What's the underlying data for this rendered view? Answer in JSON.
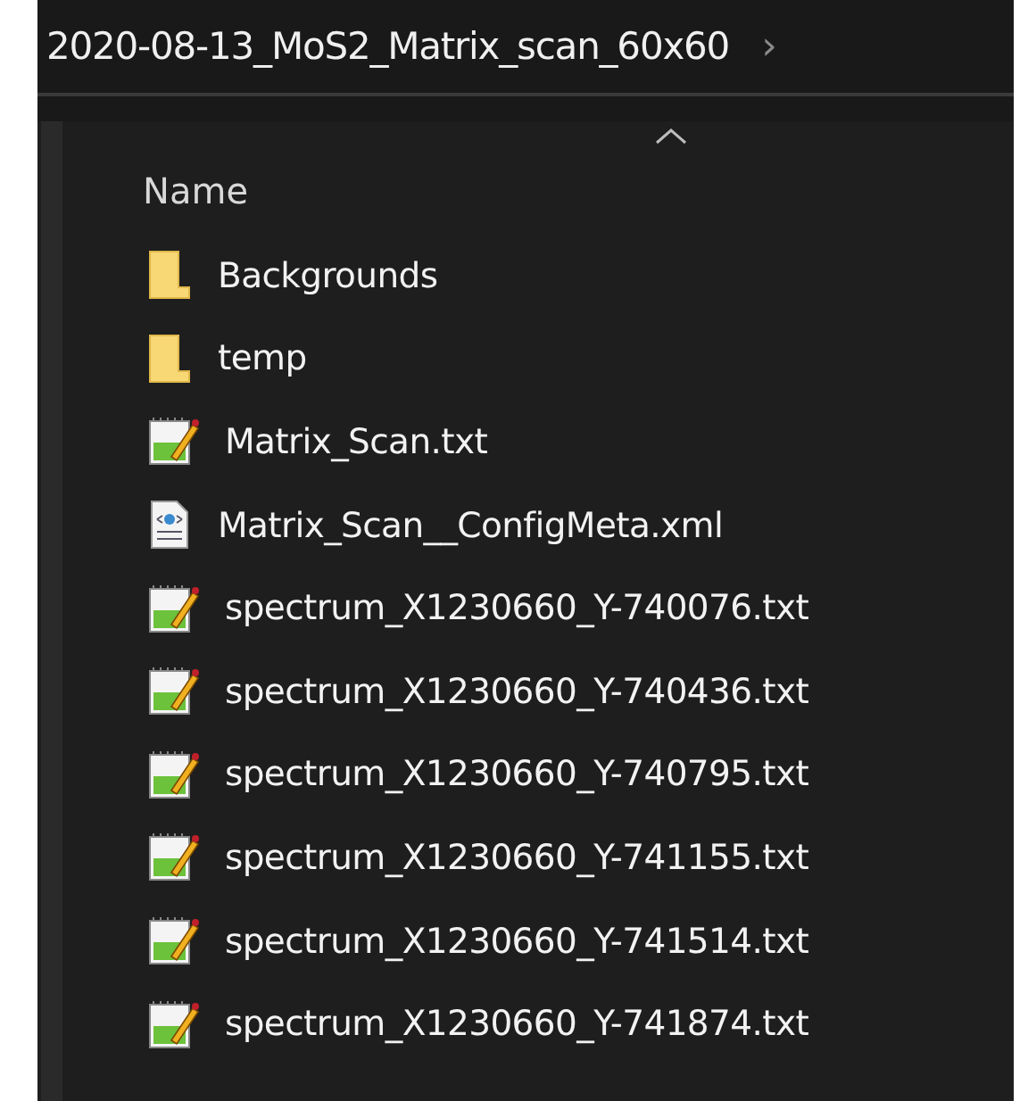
{
  "breadcrumb": {
    "folder": "2020-08-13_MoS2_Matrix_scan_60x60",
    "separator": "›"
  },
  "columns": [
    {
      "label": "Name",
      "sorted": true
    }
  ],
  "files": [
    {
      "name": "Backgrounds",
      "kind": "folder"
    },
    {
      "name": "temp",
      "kind": "folder"
    },
    {
      "name": "Matrix_Scan.txt",
      "kind": "text"
    },
    {
      "name": "Matrix_Scan__ConfigMeta.xml",
      "kind": "xml"
    },
    {
      "name": "spectrum_X1230660_Y-740076.txt",
      "kind": "text"
    },
    {
      "name": "spectrum_X1230660_Y-740436.txt",
      "kind": "text"
    },
    {
      "name": "spectrum_X1230660_Y-740795.txt",
      "kind": "text"
    },
    {
      "name": "spectrum_X1230660_Y-741155.txt",
      "kind": "text"
    },
    {
      "name": "spectrum_X1230660_Y-741514.txt",
      "kind": "text"
    },
    {
      "name": "spectrum_X1230660_Y-741874.txt",
      "kind": "text"
    }
  ]
}
